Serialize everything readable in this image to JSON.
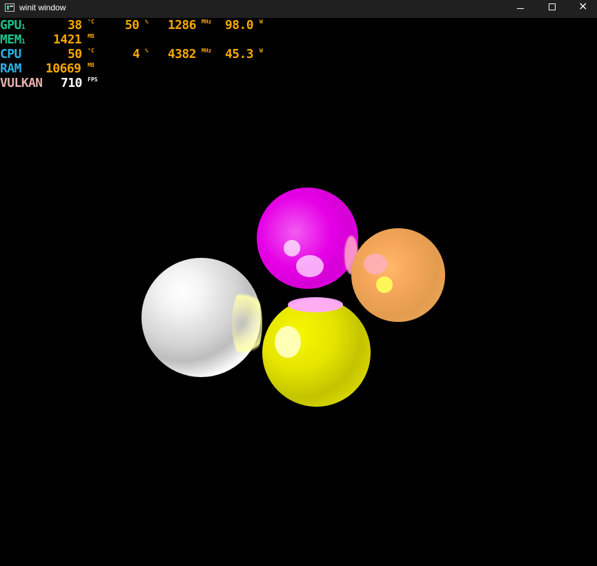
{
  "window": {
    "title": "winit window",
    "controls": {
      "minimize_icon": "minimize-icon",
      "maximize_icon": "maximize-icon",
      "close_icon": "close-icon"
    }
  },
  "hud": {
    "rows": [
      {
        "label": "GPU",
        "sub": "1",
        "label_color": "#1ec38b",
        "temp": "38",
        "temp_unit": "°C",
        "load": "50",
        "load_unit": "%",
        "clock": "1286",
        "clock_unit": "MHz",
        "power": "98.0",
        "power_unit": "W"
      },
      {
        "label": "MEM",
        "sub": "1",
        "label_color": "#1ec38b",
        "value": "1421",
        "unit": "MB"
      },
      {
        "label": "CPU",
        "label_color": "#2ab4e6",
        "temp": "50",
        "temp_unit": "°C",
        "load": "4",
        "load_unit": "%",
        "clock": "4382",
        "clock_unit": "MHz",
        "power": "45.3",
        "power_unit": "W"
      },
      {
        "label": "RAM",
        "label_color": "#2ab4e6",
        "value": "10669",
        "unit": "MB"
      },
      {
        "label": "VULKAN",
        "label_color": "#e7b2ad",
        "value": "710",
        "unit": "FPS",
        "value_color": "#ffffff",
        "unit_color": "#ffffff"
      }
    ]
  }
}
